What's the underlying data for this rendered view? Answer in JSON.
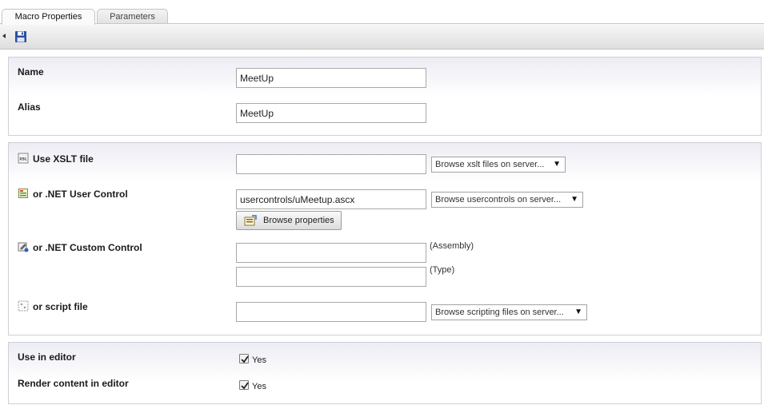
{
  "tabs": [
    {
      "label": "Macro Properties",
      "active": true
    },
    {
      "label": "Parameters",
      "active": false
    }
  ],
  "toolbar": {
    "save_icon": "floppy-disk-icon",
    "collapse_icon": "left-arrow-icon"
  },
  "basics": {
    "name_label": "Name",
    "name_value": "MeetUp",
    "alias_label": "Alias",
    "alias_value": "MeetUp"
  },
  "sources": {
    "xslt_label": "Use XSLT file",
    "xslt_value": "",
    "xslt_browse": "Browse xslt files on server...",
    "usercontrol_label": "or .NET User Control",
    "usercontrol_value": "usercontrols/uMeetup.ascx",
    "usercontrol_browse": "Browse usercontrols on server...",
    "browse_properties": "Browse properties",
    "customcontrol_label": "or .NET Custom Control",
    "assembly_value": "",
    "assembly_hint": "(Assembly)",
    "type_value": "",
    "type_hint": "(Type)",
    "script_label": "or script file",
    "script_value": "",
    "script_browse": "Browse scripting files on server..."
  },
  "editor": {
    "use_in_editor_label": "Use in editor",
    "use_in_editor_checked": true,
    "use_in_editor_option": "Yes",
    "render_content_label": "Render content in editor",
    "render_content_checked": true,
    "render_content_option": "Yes"
  },
  "colors": {
    "panel_border": "#cfcfd8",
    "panel_header": "#ececf4",
    "save_icon": "#2a4fa8"
  }
}
